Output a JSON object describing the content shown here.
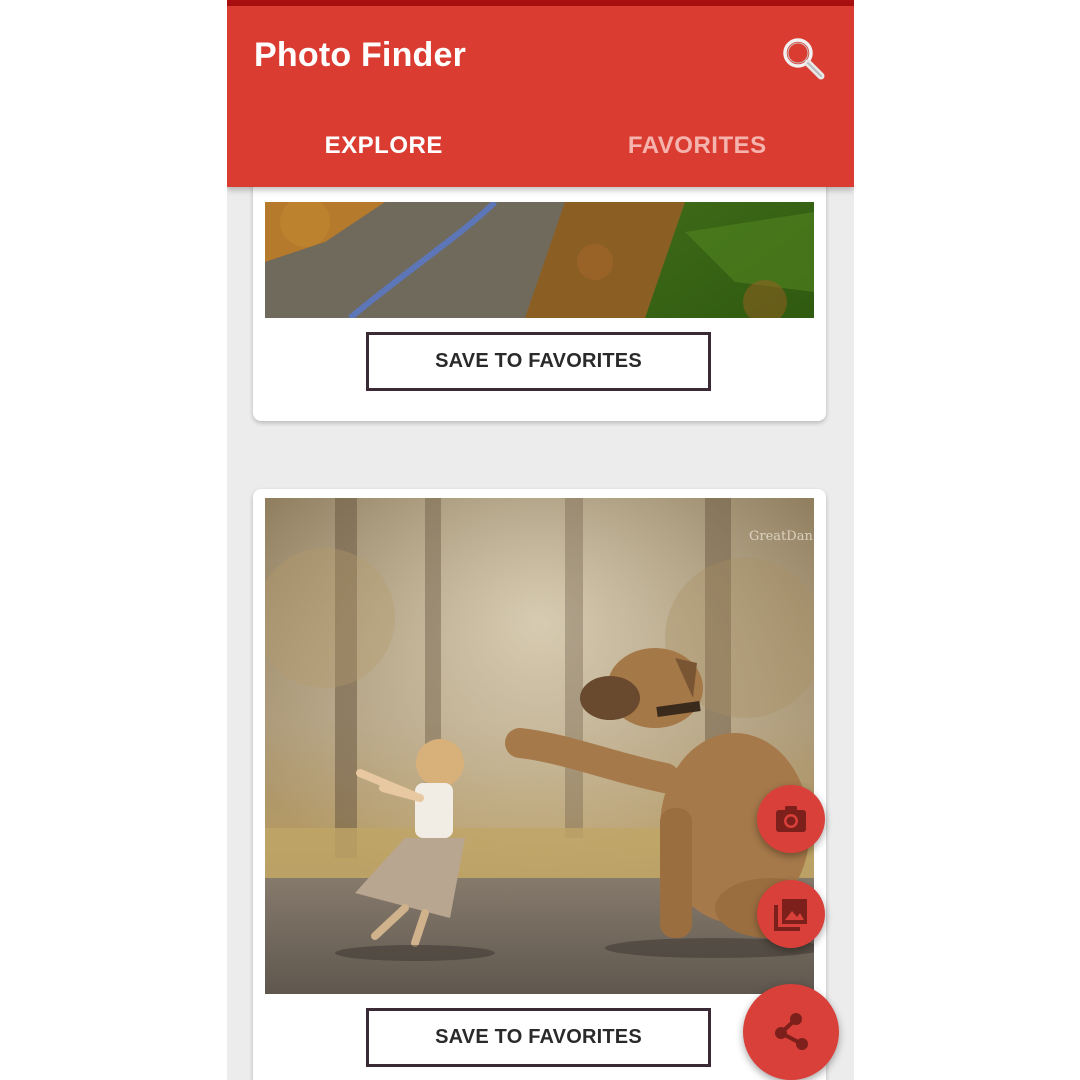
{
  "app": {
    "title": "Photo Finder",
    "accent_color": "#da3c31",
    "status_color": "#a90f10"
  },
  "toolbar": {
    "search_icon": "search-icon"
  },
  "tabs": [
    {
      "label": "EXPLORE",
      "active": true
    },
    {
      "label": "FAVORITES",
      "active": false
    }
  ],
  "cards": [
    {
      "image": "autumn-road-photo",
      "button_label": "SAVE TO FAVORITES"
    },
    {
      "image": "child-and-great-dane-photo",
      "watermark": "GreatDan",
      "button_label": "SAVE TO FAVORITES"
    }
  ],
  "fabs": [
    {
      "icon": "camera-icon"
    },
    {
      "icon": "gallery-icon"
    },
    {
      "icon": "share-icon"
    }
  ]
}
